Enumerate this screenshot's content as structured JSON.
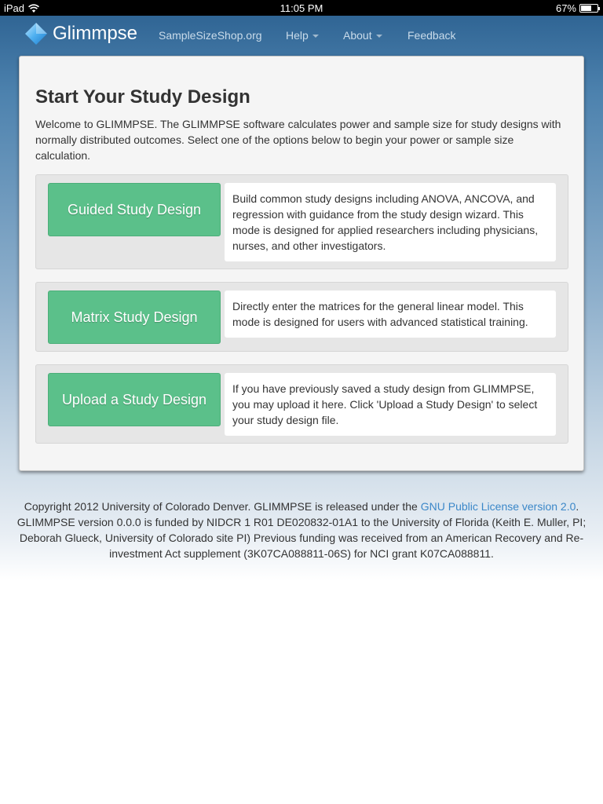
{
  "status_bar": {
    "device": "iPad",
    "time": "11:05 PM",
    "battery_text": "67%",
    "battery_level": 0.67
  },
  "navbar": {
    "brand": "Glimmpse",
    "links": {
      "samplesizeshop": "SampleSizeShop.org",
      "help": "Help",
      "about": "About",
      "feedback": "Feedback"
    }
  },
  "main": {
    "title": "Start Your Study Design",
    "intro": "Welcome to GLIMMPSE. The GLIMMPSE software calculates power and sample size for study designs with normally distributed outcomes. Select one of the options below to begin your power or sample size calculation.",
    "options": [
      {
        "button": "Guided Study Design",
        "description": "Build common study designs including ANOVA, ANCOVA, and regression with guidance from the study design wizard. This mode is designed for applied researchers including physicians, nurses, and other investigators."
      },
      {
        "button": "Matrix Study Design",
        "description": "Directly enter the matrices for the general linear model. This mode is designed for users with advanced statistical training."
      },
      {
        "button": "Upload a Study Design",
        "description": "If you have previously saved a study design from GLIMMPSE, you may upload it here. Click 'Upload a Study Design' to select your study design file."
      }
    ]
  },
  "footer": {
    "text_before_link": "Copyright 2012 University of Colorado Denver. GLIMMPSE is released under the ",
    "link": "GNU Public License version 2.0",
    "text_after_link": ". GLIMMPSE version 0.0.0 is funded by NIDCR 1 R01 DE020832-01A1 to the University of Florida (Keith E. Muller, PI; Deborah Glueck, University of Colorado site PI) Previous funding was received from an American Recovery and Re-investment Act supplement (3K07CA088811-06S) for NCI grant K07CA088811."
  },
  "colors": {
    "button_green": "#5bc08a",
    "link_blue": "#3a87c8",
    "nav_bg": "#2a5f8f"
  }
}
